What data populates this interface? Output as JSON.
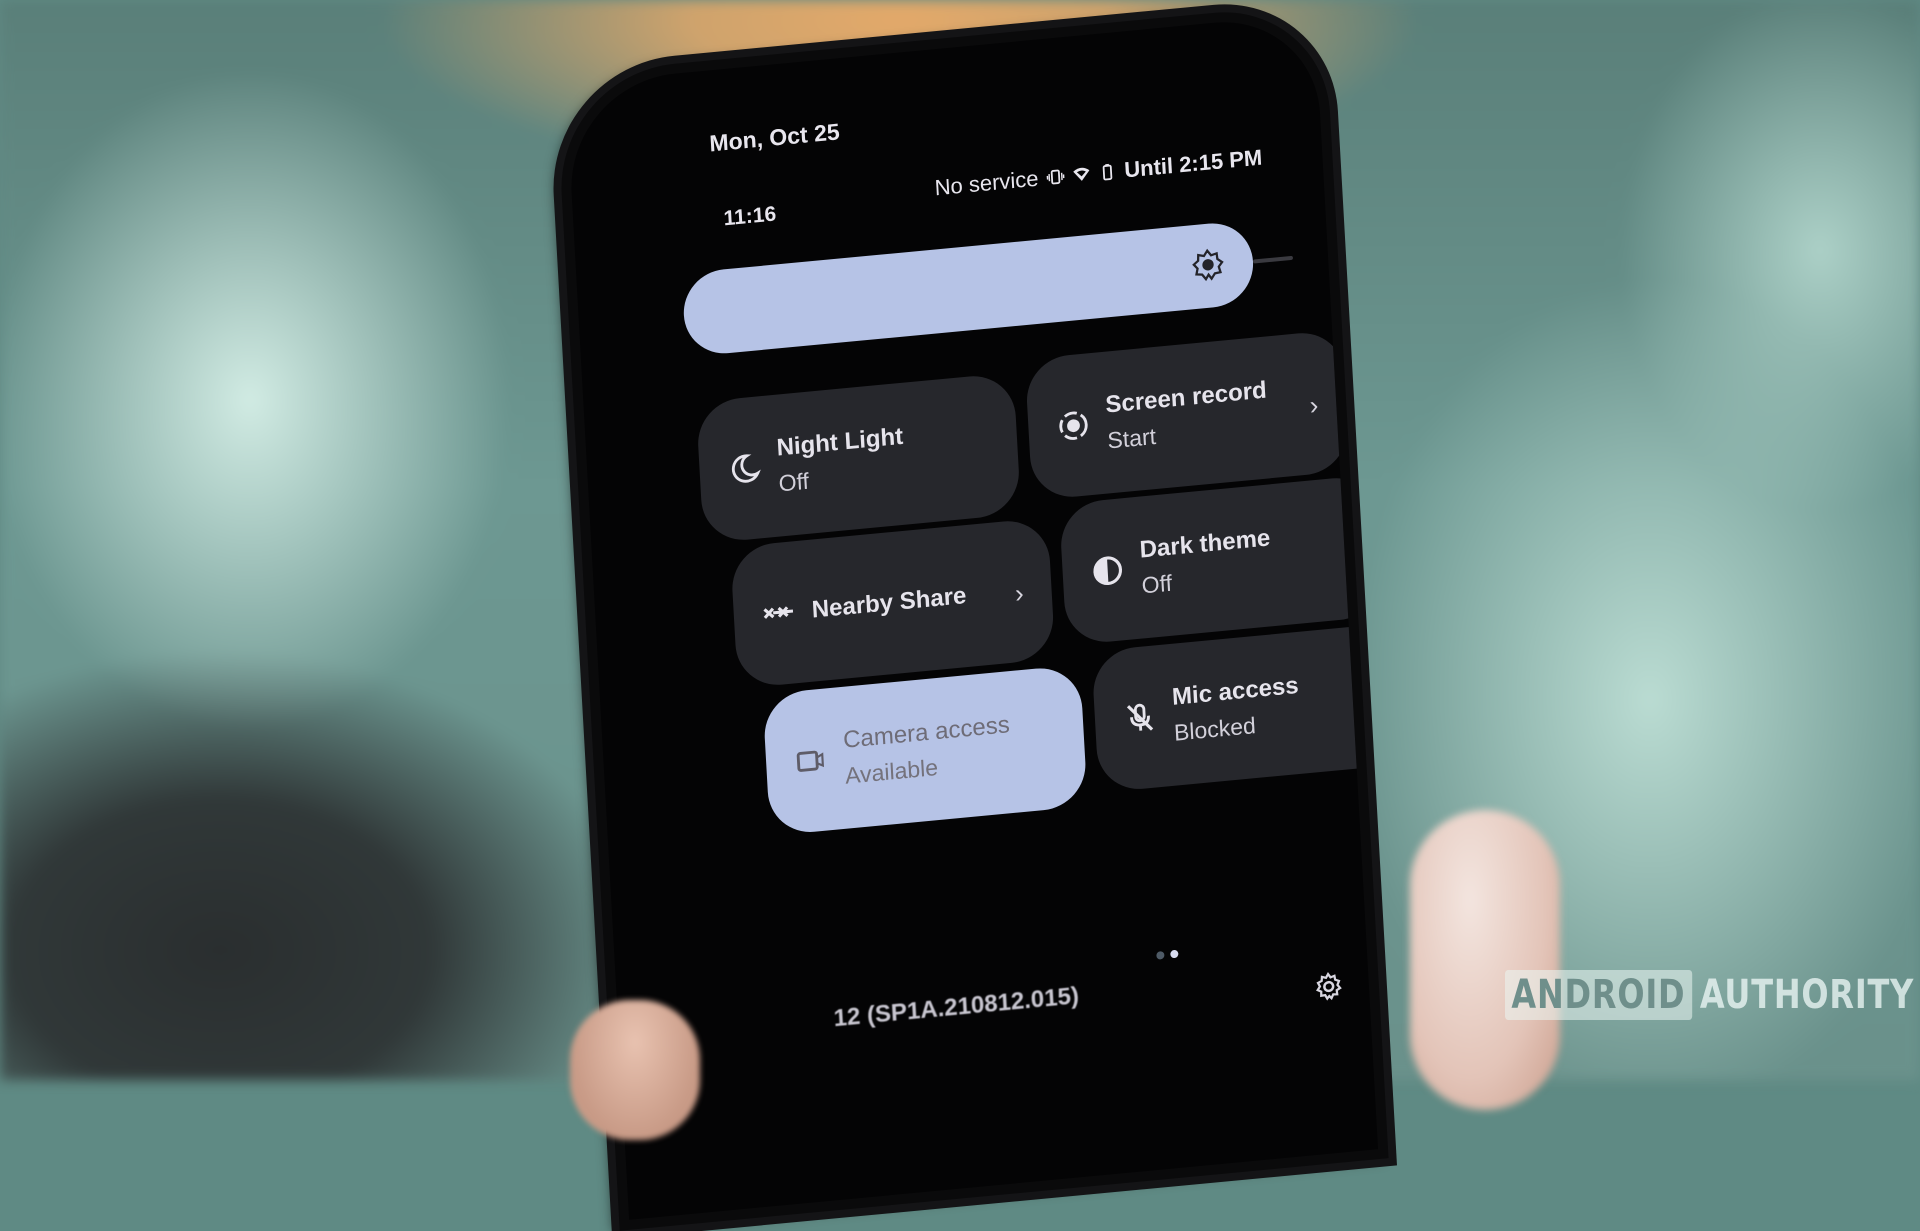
{
  "header": {
    "date": "Mon, Oct 25",
    "time": "11:16",
    "status": {
      "carrier": "No service",
      "icons": [
        "vibrate-icon",
        "wifi-icon",
        "battery-icon"
      ],
      "battery_text": "Until 2:15 PM"
    }
  },
  "brightness": {
    "icon": "brightness-icon",
    "level_percent": 100
  },
  "tiles": [
    {
      "label": "Night Light",
      "state": "Off",
      "icon": "moon-icon",
      "active": false,
      "has_chevron": false
    },
    {
      "label": "Screen record",
      "state": "Start",
      "icon": "screen-record-icon",
      "active": false,
      "has_chevron": true
    },
    {
      "label": "Nearby Share",
      "state": "",
      "icon": "nearby-share-icon",
      "active": false,
      "has_chevron": true
    },
    {
      "label": "Dark theme",
      "state": "Off",
      "icon": "contrast-icon",
      "active": false,
      "has_chevron": false
    },
    {
      "label": "Camera access",
      "state": "Available",
      "icon": "camera-icon",
      "active": true,
      "has_chevron": false
    },
    {
      "label": "Mic access",
      "state": "Blocked",
      "icon": "mic-off-icon",
      "active": false,
      "has_chevron": false
    }
  ],
  "chevron": "›",
  "footer": {
    "build_number": "12 (SP1A.210812.015)",
    "page_count": 2,
    "current_page": 2,
    "settings_icon": "settings-icon"
  },
  "watermark": {
    "part1": "ANDROID",
    "part2": "AUTHORITY"
  },
  "colors": {
    "active_tile": "#b6c3e6",
    "inactive_tile": "#26272c",
    "screen_bg": "#040405"
  }
}
